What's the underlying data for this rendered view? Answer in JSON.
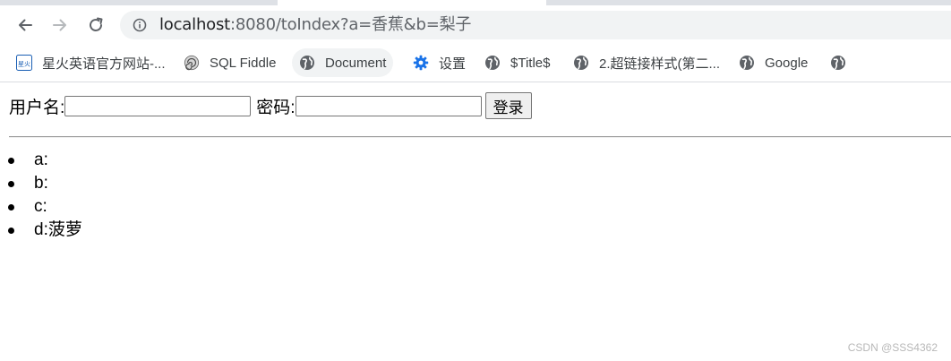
{
  "browser": {
    "url_host": "localhost",
    "url_rest": ":8080/toIndex?a=香蕉&b=梨子",
    "bookmarks": [
      {
        "label": "星火英语官方网站-...",
        "icon": "xinghuo-logo-icon",
        "icon_text": "星火"
      },
      {
        "label": "SQL Fiddle",
        "icon": "sql-fiddle-icon"
      },
      {
        "label": "Document",
        "icon": "globe-icon"
      },
      {
        "label": "设置",
        "icon": "gear-icon"
      },
      {
        "label": "$Title$",
        "icon": "globe-icon"
      },
      {
        "label": "2.超链接样式(第二...",
        "icon": "globe-icon"
      },
      {
        "label": "Google",
        "icon": "globe-icon"
      },
      {
        "label": "",
        "icon": "globe-icon"
      }
    ],
    "accent_color": "#1a73e8"
  },
  "page": {
    "username_label": "用户名:",
    "username_value": "",
    "password_label": "密码:",
    "password_value": "",
    "login_button": "登录",
    "params": [
      "a:",
      "b:",
      "c:",
      "d:菠萝"
    ]
  },
  "watermark": "CSDN @SSS4362"
}
